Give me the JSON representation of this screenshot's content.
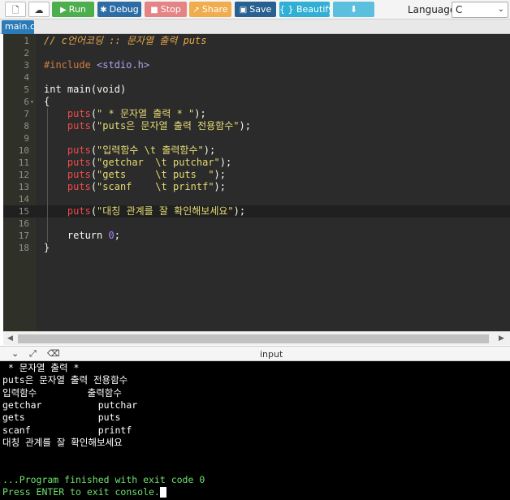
{
  "toolbar": {
    "run": "Run",
    "debug": "Debug",
    "stop": "Stop",
    "share": "Share",
    "save": "Save",
    "beautify": "{ } Beautify",
    "language_label": "Language",
    "language_value": "C",
    "icons": {
      "new": "new-file-icon",
      "upload": "upload-icon",
      "run": "play-icon",
      "debug": "bug-icon",
      "stop": "stop-icon",
      "share": "share-icon",
      "save": "save-icon",
      "download": "download-icon"
    },
    "colors": {
      "run": "#4cae4c",
      "debug": "#2e6da4",
      "stop": "#e58484",
      "share": "#f0ad4e",
      "save": "#286090",
      "beautify": "#31b0d5",
      "download": "#5bc0de"
    }
  },
  "tabs": [
    {
      "label": "main.c"
    }
  ],
  "editor": {
    "lines": [
      {
        "n": "1",
        "text": "// c언어코딩 :: 문자열 출력 puts"
      },
      {
        "n": "2",
        "text": ""
      },
      {
        "n": "3",
        "text": "#include <stdio.h>"
      },
      {
        "n": "4",
        "text": ""
      },
      {
        "n": "5",
        "text": "int main(void)"
      },
      {
        "n": "6",
        "text": "{"
      },
      {
        "n": "7",
        "text": "    puts(\" * 문자열 출력 * \");"
      },
      {
        "n": "8",
        "text": "    puts(\"puts은 문자열 출력 전용함수\");"
      },
      {
        "n": "9",
        "text": ""
      },
      {
        "n": "10",
        "text": "    puts(\"입력함수 \\t 출력함수\");"
      },
      {
        "n": "11",
        "text": "    puts(\"getchar  \\t putchar\");"
      },
      {
        "n": "12",
        "text": "    puts(\"gets     \\t puts  \");"
      },
      {
        "n": "13",
        "text": "    puts(\"scanf    \\t printf\");"
      },
      {
        "n": "14",
        "text": ""
      },
      {
        "n": "15",
        "text": "    puts(\"대칭 관계를 잘 확인해보세요\");"
      },
      {
        "n": "16",
        "text": ""
      },
      {
        "n": "17",
        "text": "    return 0;"
      },
      {
        "n": "18",
        "text": "}"
      }
    ]
  },
  "console": {
    "title": "input",
    "lines": [
      " * 문자열 출력 * ",
      "puts은 문자열 출력 전용함수",
      "입력함수         출력함수",
      "getchar          putchar",
      "gets             puts",
      "scanf            printf",
      "대칭 관계를 잘 확인해보세요",
      "",
      "",
      "...Program finished with exit code 0",
      "Press ENTER to exit console."
    ]
  }
}
